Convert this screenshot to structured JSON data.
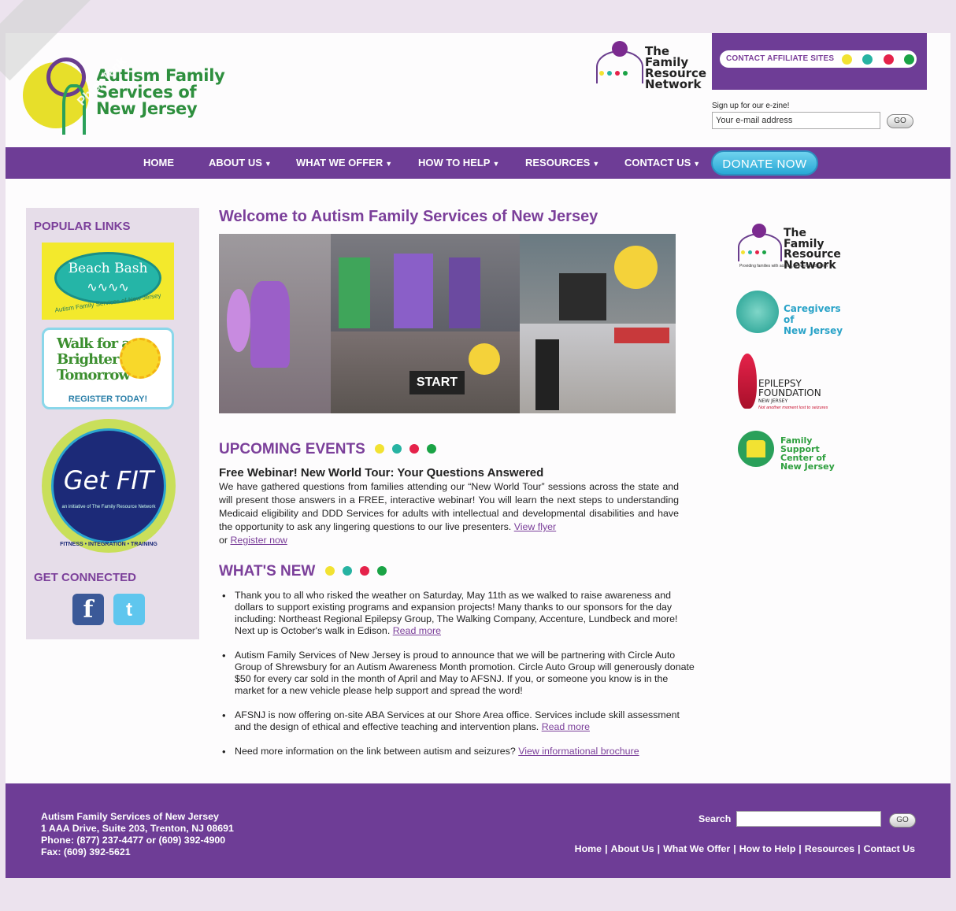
{
  "site": {
    "logo_lines": [
      "Autism Family",
      "Services of",
      "New Jersey"
    ],
    "watermark": "PhishTank"
  },
  "frn": {
    "lines": [
      "The Family",
      "Resource",
      "Network"
    ]
  },
  "affiliates": {
    "label": "CONTACT AFFILIATE SITES",
    "dot_colors": [
      "#f2e232",
      "#27b3a2",
      "#e5224a",
      "#1aa345"
    ]
  },
  "ezine": {
    "label": "Sign up for our e-zine!",
    "placeholder": "Your e-mail address",
    "go": "GO"
  },
  "nav": {
    "items": [
      {
        "label": "HOME",
        "caret": false
      },
      {
        "label": "ABOUT US",
        "caret": true
      },
      {
        "label": "WHAT WE OFFER",
        "caret": true
      },
      {
        "label": "HOW TO HELP",
        "caret": true
      },
      {
        "label": "RESOURCES",
        "caret": true
      },
      {
        "label": "CONTACT US",
        "caret": true
      }
    ],
    "donate": "DONATE NOW"
  },
  "sidebar": {
    "popular_title": "POPULAR LINKS",
    "beach_bash": "Beach Bash",
    "beach_bash_sub": "Autism Family Services of New Jersey",
    "walk_lines": [
      "Walk for a",
      "Brighter",
      "Tomorrow"
    ],
    "walk_register": "REGISTER TODAY!",
    "getfit": "Get FIT",
    "getfit_sub": "an initiative of The Family Resource Network",
    "getfit_tag": "FITNESS • INTEGRATION • TRAINING",
    "connected_title": "GET CONNECTED"
  },
  "main": {
    "title": "Welcome to Autism Family Services of New Jersey",
    "events_title": "UPCOMING EVENTS",
    "event_heading": "Free Webinar! New World Tour: Your Questions Answered",
    "event_text": "We have gathered questions from families attending our “New World Tour” sessions across the state and will present those answers in a FREE, interactive webinar! You will learn the next steps to understanding Medicaid eligibility and DDD Services for adults with intellectual and developmental disabilities and have the opportunity to ask any lingering questions to our live presenters.",
    "event_link1": "View flyer",
    "event_or": "or",
    "event_link2": "Register now",
    "news_title": "WHAT'S NEW",
    "news": [
      {
        "text": "Thank you to all who risked the weather on Saturday, May 11th as we walked to raise awareness and dollars to support existing programs and expansion projects! Many thanks to our sponsors for the day including: Northeast Regional Epilepsy Group, The Walking Company, Accenture, Lundbeck and more! Next up is October's walk in Edison.",
        "link": "Read more"
      },
      {
        "text": "Autism Family Services of New Jersey is proud to announce that we will be partnering with Circle Auto Group of Shrewsbury for an Autism Awareness Month promotion. Circle Auto Group will generously donate $50 for every car sold in the month of April and May to AFSNJ. If you, or someone you know is in the market for a new vehicle please help support and spread the word!",
        "link": ""
      },
      {
        "text": "AFSNJ is now offering on-site ABA Services at our Shore Area office. Services include skill assessment and the design of ethical and effective teaching and intervention plans.",
        "link": "Read more"
      },
      {
        "text": "Need more information on the link between autism and seizures?",
        "link": "View informational brochure"
      }
    ]
  },
  "photos": {
    "start_sign": "START"
  },
  "partners": {
    "frn_lines": [
      "The Family",
      "Resource",
      "Network"
    ],
    "frn_tag": "Providing families with access, answers and action",
    "caregivers": [
      "Caregivers of",
      "New Jersey"
    ],
    "epilepsy": [
      "EPILEPSY",
      "FOUNDATION",
      "NEW JERSEY"
    ],
    "epilepsy_tag": "Not another moment lost to seizures",
    "fsc": [
      "Family Support",
      "Center of",
      "New Jersey"
    ]
  },
  "footer": {
    "address": [
      "Autism Family Services of New Jersey",
      "1 AAA Drive, Suite 203, Trenton, NJ 08691",
      "Phone: (877) 237-4477 or (609) 392-4900",
      "Fax: (609) 392-5621"
    ],
    "search_label": "Search",
    "go": "GO",
    "links": [
      "Home",
      "About Us",
      "What We Offer",
      "How to Help",
      "Resources",
      "Contact Us"
    ]
  }
}
